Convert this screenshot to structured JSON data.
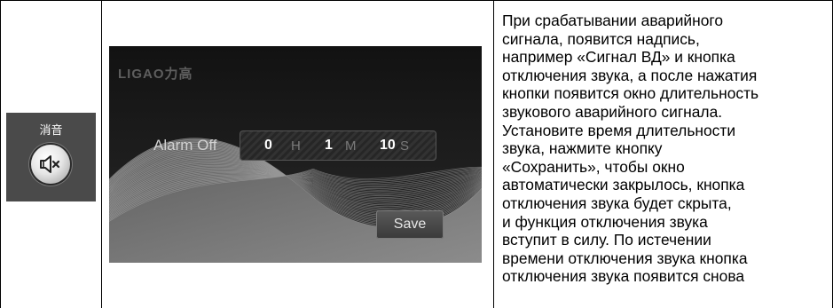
{
  "mute_cell": {
    "caption": "消音",
    "icon": "speaker-mute-icon"
  },
  "screen": {
    "logo": "LIGAO力高",
    "alarm_label": "Alarm Off",
    "hours_value": "0",
    "hours_unit": "H",
    "minutes_value": "1",
    "minutes_unit": "M",
    "seconds_value": "10",
    "seconds_unit": "S",
    "save_label": "Save"
  },
  "description_lines": [
    "При срабатывании аварийного",
    "сигнала, появится надпись,",
    "например «Сигнал ВД» и кнопка",
    "отключения звука, а после нажатия",
    "кнопки появится окно длительность",
    "звукового аварийного сигнала.",
    "Установите время длительности",
    "звука, нажмите кнопку",
    "«Сохранить», чтобы окно",
    "автоматически закрылось, кнопка",
    "отключения звука будет скрыта,",
    "и функция отключения звука",
    "вступит в силу. По истечении",
    "времени отключения звука кнопка",
    "отключения звука появится снова"
  ]
}
